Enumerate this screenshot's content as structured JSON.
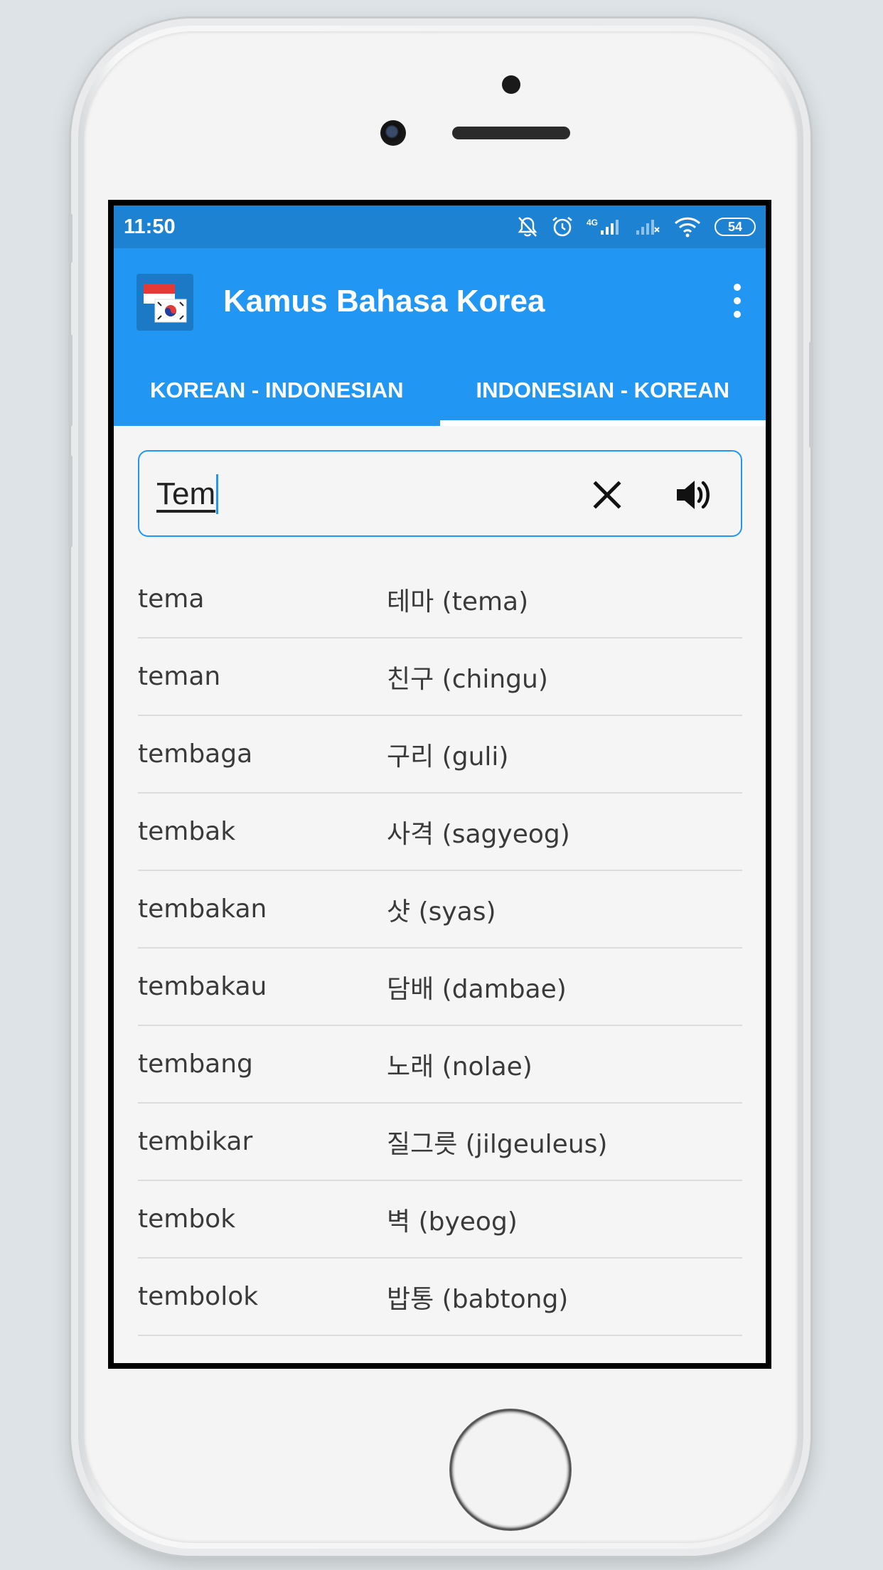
{
  "status_bar": {
    "time": "11:50",
    "network_label": "4G",
    "battery": "54"
  },
  "app": {
    "title": "Kamus Bahasa Korea",
    "accent_color": "#2196f3",
    "status_color": "#1e82d2"
  },
  "tabs": [
    {
      "label": "KOREAN - INDONESIAN",
      "active": false
    },
    {
      "label": "INDONESIAN - KOREAN",
      "active": true
    }
  ],
  "search": {
    "value": "Tem"
  },
  "results": [
    {
      "word": "tema",
      "translation": "테마 (tema)"
    },
    {
      "word": "teman",
      "translation": "친구 (chingu)"
    },
    {
      "word": "tembaga",
      "translation": "구리 (guli)"
    },
    {
      "word": "tembak",
      "translation": "사격 (sagyeog)"
    },
    {
      "word": "tembakan",
      "translation": "샷 (syas)"
    },
    {
      "word": "tembakau",
      "translation": "담배 (dambae)"
    },
    {
      "word": "tembang",
      "translation": "노래 (nolae)"
    },
    {
      "word": "tembikar",
      "translation": "질그릇 (jilgeuleus)"
    },
    {
      "word": "tembok",
      "translation": "벽 (byeog)"
    },
    {
      "word": "tembolok",
      "translation": "밥통 (babtong)"
    }
  ],
  "icons": {
    "app_logo": "indonesia-korea-flag-icon",
    "clear": "close-icon",
    "speak": "speaker-icon",
    "menu": "more-vert-icon"
  }
}
